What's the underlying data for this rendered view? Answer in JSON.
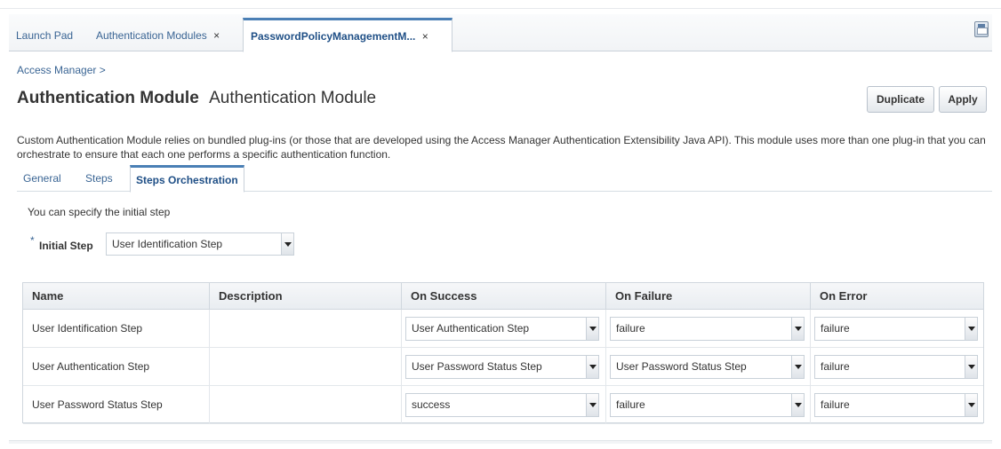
{
  "tabs": [
    {
      "label": "Launch Pad"
    },
    {
      "label": "Authentication Modules",
      "close": "×"
    },
    {
      "label": "PasswordPolicyManagementM...",
      "close": "×"
    }
  ],
  "breadcrumb": "Access Manager >",
  "header": {
    "title": "Authentication Module",
    "subtitle": "Authentication Module",
    "duplicate_label": "Duplicate",
    "apply_label": "Apply"
  },
  "description": "Custom Authentication Module relies on bundled plug-ins (or those that are developed using the Access Manager Authentication Extensibility Java API). This module uses more than one plug-in that you can orchestrate to ensure that each one performs a specific authentication function.",
  "subtabs": [
    {
      "label": "General"
    },
    {
      "label": "Steps"
    },
    {
      "label": "Steps Orchestration"
    }
  ],
  "hint": "You can specify the initial step",
  "initial_step": {
    "required_mark": "*",
    "label": "Initial Step",
    "value": "User Identification Step"
  },
  "table": {
    "columns": [
      "Name",
      "Description",
      "On Success",
      "On Failure",
      "On Error"
    ],
    "rows": [
      {
        "name": "User Identification Step",
        "description": "",
        "on_success": "User Authentication Step",
        "on_failure": "failure",
        "on_error": "failure"
      },
      {
        "name": "User Authentication Step",
        "description": "",
        "on_success": "User Password Status Step",
        "on_failure": "User Password Status Step",
        "on_error": "failure"
      },
      {
        "name": "User Password Status Step",
        "description": "",
        "on_success": "success",
        "on_failure": "failure",
        "on_error": "failure"
      }
    ]
  },
  "icons": {
    "save": "save-icon",
    "dropdown": "chevron-down-icon"
  },
  "colors": {
    "link": "#3a6594",
    "active_tab_border": "#4a7fb5",
    "text": "#333333"
  }
}
